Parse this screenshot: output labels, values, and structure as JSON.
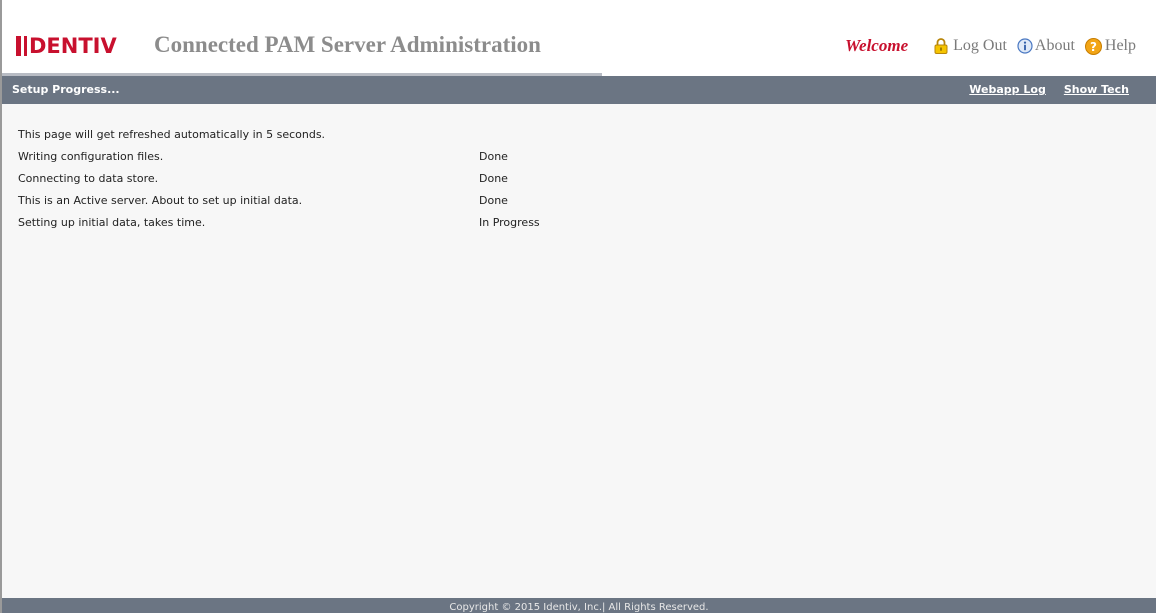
{
  "header": {
    "logo_text": "DENTIV",
    "app_title": "Connected PAM Server Administration",
    "welcome": "Welcome",
    "logout_label": "Log Out",
    "about_label": "About",
    "help_label": "Help",
    "icons": {
      "logout": "lock-icon",
      "about": "info-icon",
      "help": "help-icon"
    },
    "colors": {
      "brand_red": "#c8102e",
      "title_gray": "#8c8c8c"
    }
  },
  "nav": {
    "title": "Setup Progress...",
    "links": [
      "Webapp Log",
      "Show Tech"
    ],
    "bar_color": "#6b7583"
  },
  "main": {
    "refresh_note": "This page will get refreshed automatically in 5 seconds.",
    "steps": [
      {
        "label": "Writing configuration files.",
        "status": "Done"
      },
      {
        "label": "Connecting to data store.",
        "status": "Done"
      },
      {
        "label": "This is an Active server. About to set up initial data.",
        "status": "Done"
      },
      {
        "label": "Setting up initial data, takes time.",
        "status": "In Progress"
      }
    ]
  },
  "footer": {
    "copyright": "Copyright © 2015 Identiv, Inc.| All Rights Reserved."
  }
}
